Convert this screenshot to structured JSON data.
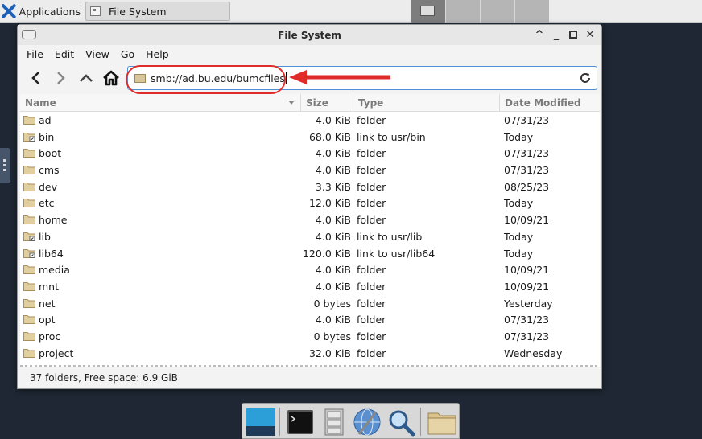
{
  "top_panel": {
    "apps_label": "Applications",
    "task_title": "File System"
  },
  "window": {
    "title": "File System",
    "menu": [
      "File",
      "Edit",
      "View",
      "Go",
      "Help"
    ],
    "location": "smb://ad.bu.edu/bumcfiles",
    "annotation_color": "#e02b2b",
    "columns": {
      "name": "Name",
      "size": "Size",
      "type": "Type",
      "date": "Date Modified"
    },
    "rows": [
      {
        "name": "ad",
        "size": "4.0 KiB",
        "type": "folder",
        "date": "07/31/23",
        "icon": "folder-icon"
      },
      {
        "name": "bin",
        "size": "68.0 KiB",
        "type": "link to usr/bin",
        "date": "Today",
        "icon": "folder-link-icon"
      },
      {
        "name": "boot",
        "size": "4.0 KiB",
        "type": "folder",
        "date": "07/31/23",
        "icon": "folder-icon"
      },
      {
        "name": "cms",
        "size": "4.0 KiB",
        "type": "folder",
        "date": "07/31/23",
        "icon": "folder-icon"
      },
      {
        "name": "dev",
        "size": "3.3 KiB",
        "type": "folder",
        "date": "08/25/23",
        "icon": "folder-icon"
      },
      {
        "name": "etc",
        "size": "12.0 KiB",
        "type": "folder",
        "date": "Today",
        "icon": "folder-icon"
      },
      {
        "name": "home",
        "size": "4.0 KiB",
        "type": "folder",
        "date": "10/09/21",
        "icon": "folder-icon"
      },
      {
        "name": "lib",
        "size": "4.0 KiB",
        "type": "link to usr/lib",
        "date": "Today",
        "icon": "folder-link-icon"
      },
      {
        "name": "lib64",
        "size": "120.0 KiB",
        "type": "link to usr/lib64",
        "date": "Today",
        "icon": "folder-link-icon"
      },
      {
        "name": "media",
        "size": "4.0 KiB",
        "type": "folder",
        "date": "10/09/21",
        "icon": "folder-icon"
      },
      {
        "name": "mnt",
        "size": "4.0 KiB",
        "type": "folder",
        "date": "10/09/21",
        "icon": "folder-icon"
      },
      {
        "name": "net",
        "size": "0 bytes",
        "type": "folder",
        "date": "Yesterday",
        "icon": "folder-icon"
      },
      {
        "name": "opt",
        "size": "4.0 KiB",
        "type": "folder",
        "date": "07/31/23",
        "icon": "folder-icon"
      },
      {
        "name": "proc",
        "size": "0 bytes",
        "type": "folder",
        "date": "07/31/23",
        "icon": "folder-icon"
      },
      {
        "name": "project",
        "size": "32.0 KiB",
        "type": "folder",
        "date": "Wednesday",
        "icon": "folder-icon"
      }
    ],
    "status": "37 folders, Free space: 6.9 GiB"
  },
  "dock_icons": [
    "desktop-icon",
    "terminal-icon",
    "file-cabinet-icon",
    "web-browser-icon",
    "search-icon",
    "file-manager-icon"
  ]
}
